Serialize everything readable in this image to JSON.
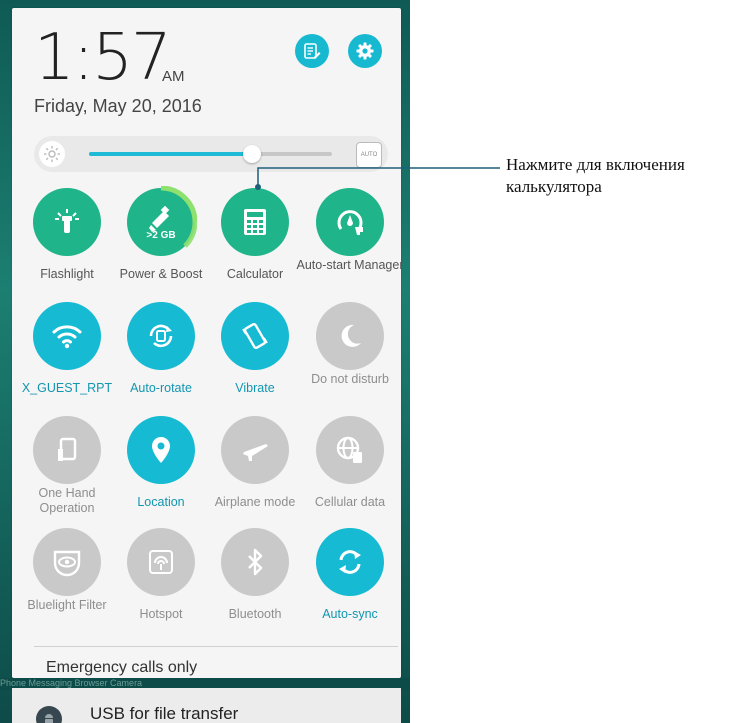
{
  "header": {
    "time": "1:57",
    "ampm": "AM",
    "date": "Friday, May 20, 2016"
  },
  "brightness": {
    "level": 0.67,
    "auto_label": "AUTO"
  },
  "tiles": [
    {
      "label": "Flashlight",
      "state": "on",
      "icon": "flashlight-icon"
    },
    {
      "label": "Power & Boost",
      "state": "on",
      "icon": "boost-icon",
      "badge": ">2 GB"
    },
    {
      "label": "Calculator",
      "state": "on",
      "icon": "calculator-icon"
    },
    {
      "label": "Auto-start Manager",
      "state": "on",
      "icon": "auto-start-icon"
    },
    {
      "label": "X_GUEST_RPT",
      "state": "on",
      "icon": "wifi-icon"
    },
    {
      "label": "Auto-rotate",
      "state": "on",
      "icon": "auto-rotate-icon"
    },
    {
      "label": "Vibrate",
      "state": "on",
      "icon": "vibrate-icon"
    },
    {
      "label": "Do not disturb",
      "state": "off",
      "icon": "moon-icon"
    },
    {
      "label": "One Hand Operation",
      "state": "off",
      "icon": "one-hand-icon"
    },
    {
      "label": "Location",
      "state": "on",
      "icon": "location-icon"
    },
    {
      "label": "Airplane mode",
      "state": "off",
      "icon": "airplane-icon"
    },
    {
      "label": "Cellular data",
      "state": "off",
      "icon": "cellular-data-icon"
    },
    {
      "label": "Bluelight Filter",
      "state": "off",
      "icon": "eye-icon"
    },
    {
      "label": "Hotspot",
      "state": "off",
      "icon": "hotspot-icon"
    },
    {
      "label": "Bluetooth",
      "state": "off",
      "icon": "bluetooth-icon"
    },
    {
      "label": "Auto-sync",
      "state": "on",
      "icon": "sync-icon"
    }
  ],
  "status": {
    "emergency": "Emergency calls only"
  },
  "dock_ghost": "Phone      Messaging                                  Browser       Camera",
  "notification": {
    "title": "USB for file transfer"
  },
  "callout": {
    "text": "Нажмите для включения калькулятора"
  },
  "colors": {
    "green": "#1fb489",
    "blue": "#16bad3",
    "grey": "#c9c9c9"
  }
}
